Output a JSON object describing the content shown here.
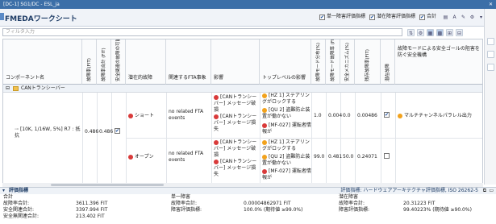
{
  "titlebar": {
    "title": "[DC-1] SG1/DC - ESL_ja",
    "close": "✕"
  },
  "header": {
    "title": "FMEDAワークシート",
    "options": [
      {
        "label": "単一障害評価指標",
        "checked": true
      },
      {
        "label": "潜在障害評価指標",
        "checked": true
      },
      {
        "label": "合計",
        "checked": true
      }
    ]
  },
  "filter": {
    "placeholder": "フィルタ入力"
  },
  "columns": {
    "component": "コンポーネント名",
    "fit_failure": "故障率(FIT)",
    "fit_failure2": "故障率合計 (FIT)",
    "safety_related": "安全関連の故障の可能性はありますか",
    "mode": "潜在的故障",
    "fta": "関連するFTA事象",
    "effect": "影響",
    "top_effect": "トップレベルの影響",
    "distribution": "故障モード分布(%)",
    "mode_rate": "故障モード故障率 (FIT)",
    "spf_cov": "安全メカニズム(%)",
    "residual": "残存故障率(FIT)",
    "latent": "潜在故障",
    "mechanism": "故障モードによる安全ゴールの阻害を防ぐ安全機構"
  },
  "group": {
    "label": "CANトランシーバー"
  },
  "component": {
    "name": "[10K, 1/16W, 5%] R7 : 抵抗",
    "fit": "0.486",
    "fit_total": "0.486",
    "safety_checked": "✔"
  },
  "rows": [
    {
      "mode": "ショート",
      "fta": "no related FTA events",
      "effects": [
        "[CANトランシーバー] メッセージ破損",
        "[CANトランシーバー] メッセージ損失"
      ],
      "top": [
        "[HZ 1] ステアリングがロックする",
        "[QU 2] 盗難防止装置が働かない",
        "[MF-027] 運転者情報が"
      ],
      "dist": "1.0",
      "rate": "0.004",
      "cov": "0.0",
      "residual": "0.00486",
      "latent_checked": "✔",
      "mechanism": "マルチチャンネルパラレル出力"
    },
    {
      "mode": "オープン",
      "fta": "no related FTA events",
      "effects": [
        "[CANトランシーバー] メッセージ破損",
        "[CANトランシーバー] メッセージ損失"
      ],
      "top": [
        "[HZ 1] ステアリングがロックする",
        "[QU 2] 盗難防止装置が働かない",
        "[MF-027] 運転者情報が"
      ],
      "dist": "99.0",
      "rate": "0.481",
      "cov": "50.0",
      "residual": "0.24071",
      "latent_checked": "",
      "mechanism": ""
    }
  ],
  "summary": {
    "panel_title": "評価指標",
    "panel_right": "評価指標: ハードウェアアーキテクチャ評価指標, ISO 26262-5",
    "total": {
      "title": "合計",
      "rows": [
        {
          "k": "故障率合計:",
          "v": "3611.396 FIT"
        },
        {
          "k": "安全関連合計:",
          "v": "3397.994 FIT"
        },
        {
          "k": "安全無関連合計:",
          "v": "213.402 FIT"
        }
      ]
    },
    "spf": {
      "title": "単一障害",
      "rows": [
        {
          "k": "故障率合計:",
          "v": "0.00004862971 FIT"
        },
        {
          "k": "障害評価指標:",
          "v": "100.0% (期待値 ≥99.0%)"
        }
      ]
    },
    "lf": {
      "title": "潜在障害",
      "rows": [
        {
          "k": "故障率合計:",
          "v": "20.31223 FIT"
        },
        {
          "k": "障害評価指標:",
          "v": "99.40223% (期待値 ≥90.0%)"
        }
      ]
    }
  }
}
